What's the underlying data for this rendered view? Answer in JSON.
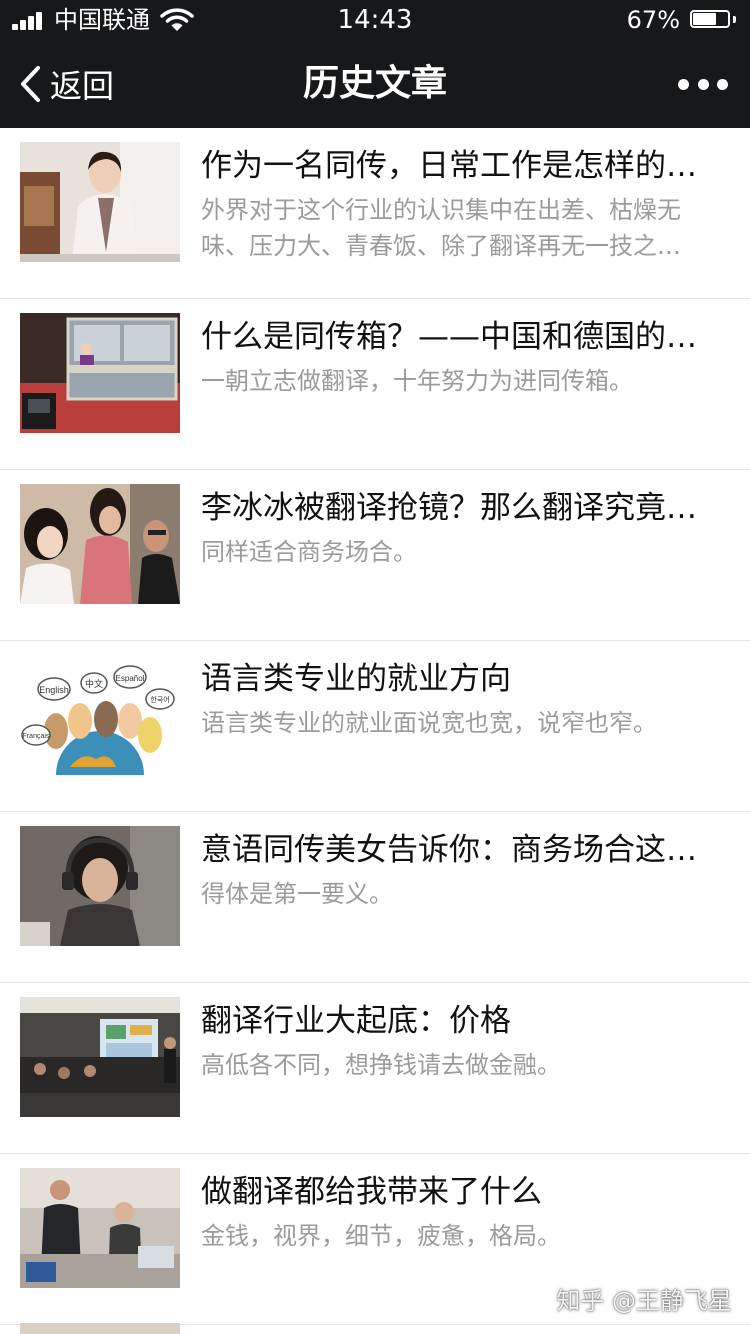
{
  "status_bar": {
    "carrier": "中国联通",
    "time": "14:43",
    "battery_percent": "67%",
    "battery_level": 0.67
  },
  "nav": {
    "back_label": "返回",
    "title": "历史文章"
  },
  "articles": [
    {
      "title": "作为一名同传，日常工作是怎样的…",
      "desc": "外界对于这个行业的认识集中在出差、枯燥无味、压力大、青春饭、除了翻译再无一技之…",
      "thumb": "woman-portrait"
    },
    {
      "title": "什么是同传箱？——中国和德国的…",
      "desc": "一朝立志做翻译，十年努力为进同传箱。",
      "thumb": "booth"
    },
    {
      "title": "李冰冰被翻译抢镜？那么翻译究竟…",
      "desc": "同样适合商务场合。",
      "thumb": "celebrity"
    },
    {
      "title": "语言类专业的就业方向",
      "desc": "语言类专业的就业面说宽也宽，说窄也窄。",
      "thumb": "languages"
    },
    {
      "title": "意语同传美女告诉你：商务场合这…",
      "desc": "得体是第一要义。",
      "thumb": "headset"
    },
    {
      "title": "翻译行业大起底：价格",
      "desc": "高低各不同，想挣钱请去做金融。",
      "thumb": "conference"
    },
    {
      "title": "做翻译都给我带来了什么",
      "desc": "金钱，视界，细节，疲惫，格局。",
      "thumb": "meeting"
    }
  ],
  "thumb_labels": {
    "english": "English",
    "chinese": "中文",
    "espanol": "Español",
    "korean": "한국어",
    "francais": "Français"
  },
  "watermark": "知乎 @王静飞星"
}
